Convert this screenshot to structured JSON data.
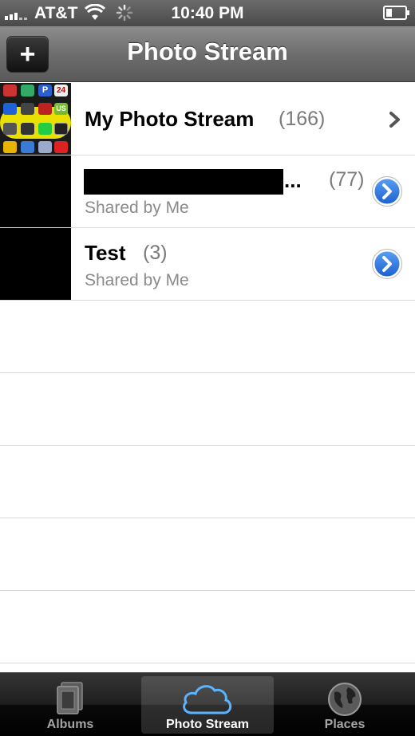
{
  "status_bar": {
    "carrier": "AT&T",
    "time": "10:40 PM"
  },
  "nav": {
    "add_label": "+",
    "title": "Photo Stream"
  },
  "streams": [
    {
      "title": "My Photo Stream",
      "count": "(166)",
      "subtitle": ""
    },
    {
      "title": "...",
      "count": "(77)",
      "subtitle": "Shared by Me"
    },
    {
      "title": "Test",
      "count": "(3)",
      "subtitle": "Shared by Me"
    }
  ],
  "thumb_apps": [
    "P",
    "24",
    "US"
  ],
  "tabs": [
    {
      "label": "Albums",
      "icon": "albums-icon",
      "active": false
    },
    {
      "label": "Photo Stream",
      "icon": "cloud-icon",
      "active": true
    },
    {
      "label": "Places",
      "icon": "globe-icon",
      "active": false
    }
  ],
  "colors": {
    "accent_blue": "#2a6fdb",
    "nav_gray": "#6e6e6e"
  }
}
